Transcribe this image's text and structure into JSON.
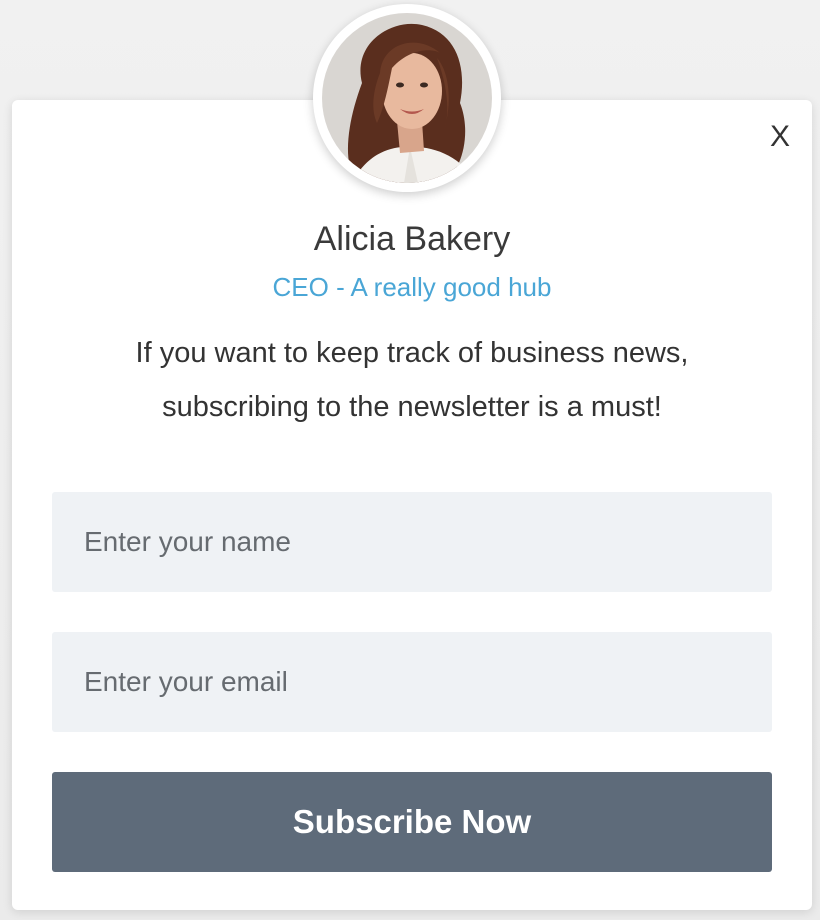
{
  "popup": {
    "close_label": "X",
    "person_name": "Alicia Bakery",
    "person_role": "CEO - A really good hub",
    "message_line1": "If you want to keep track of business news,",
    "message_line2": "subscribing to the newsletter is a must!"
  },
  "form": {
    "name_placeholder": "Enter your name",
    "email_placeholder": "Enter your email",
    "submit_label": "Subscribe Now"
  },
  "colors": {
    "accent": "#4aa6d6",
    "button": "#5e6b7a",
    "field_bg": "#eff2f5"
  },
  "icons": {
    "close": "close-icon"
  }
}
